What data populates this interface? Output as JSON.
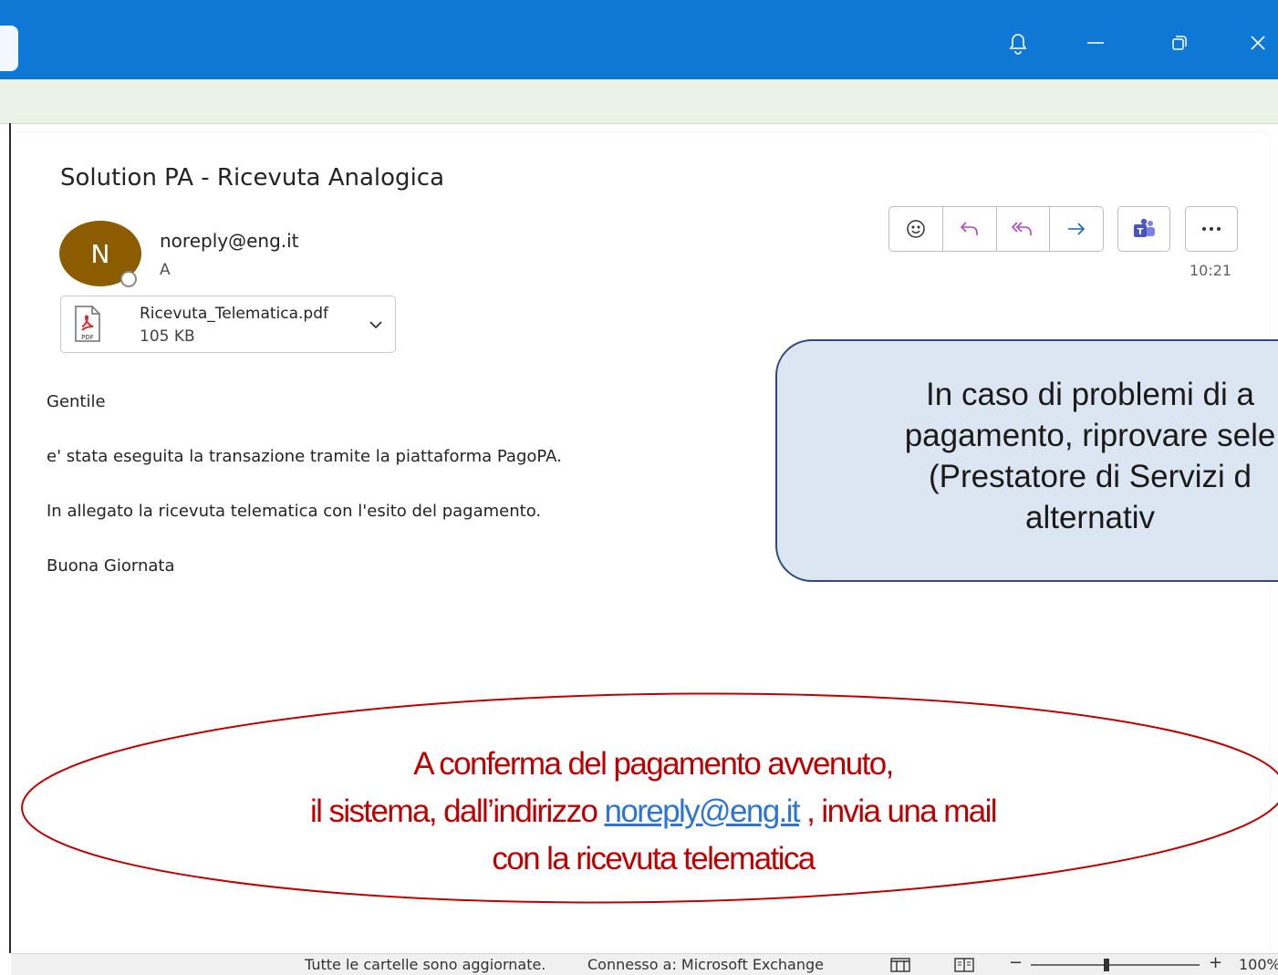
{
  "email": {
    "subject": "Solution PA - Ricevuta Analogica",
    "avatar_initial": "N",
    "sender": "noreply@eng.it",
    "to": "A",
    "time": "10:21",
    "attachment": {
      "name": "Ricevuta_Telematica.pdf",
      "size": "105 KB"
    },
    "body": [
      "Gentile",
      "e' stata eseguita la transazione tramite la piattaforma PagoPA.",
      "In allegato la ricevuta telematica con l'esito del pagamento.",
      "Buona Giornata"
    ]
  },
  "callout": {
    "lines": [
      "In caso di problemi di a",
      "pagamento, riprovare sele",
      "(Prestatore di Servizi d",
      "alternativ"
    ]
  },
  "oval": {
    "line1": "A conferma del pagamento avvenuto,",
    "line2_pre": "il sistema,  dall’indirizzo ",
    "line2_link": "noreply@eng.it",
    "line2_post": " , invia una mail",
    "line3": "con la ricevuta telematica"
  },
  "status": {
    "folders": "Tutte le cartelle sono aggiornate.",
    "connection": "Connesso a: Microsoft Exchange",
    "zoom": "100%",
    "zoom_fraction": 0.45
  },
  "icons": [
    "bell-icon",
    "minimize-icon",
    "restore-icon",
    "close-icon",
    "emoji-icon",
    "reply-icon",
    "reply-all-icon",
    "forward-icon",
    "teams-icon",
    "more-icon",
    "pdf-icon",
    "chevron-down-icon"
  ],
  "colors": {
    "titlebar": "#0f78d4",
    "accent_purple": "#b146c2",
    "avatar": "#8b5d00",
    "oval_text": "#c00000",
    "callout_fill": "#dce6f2"
  }
}
